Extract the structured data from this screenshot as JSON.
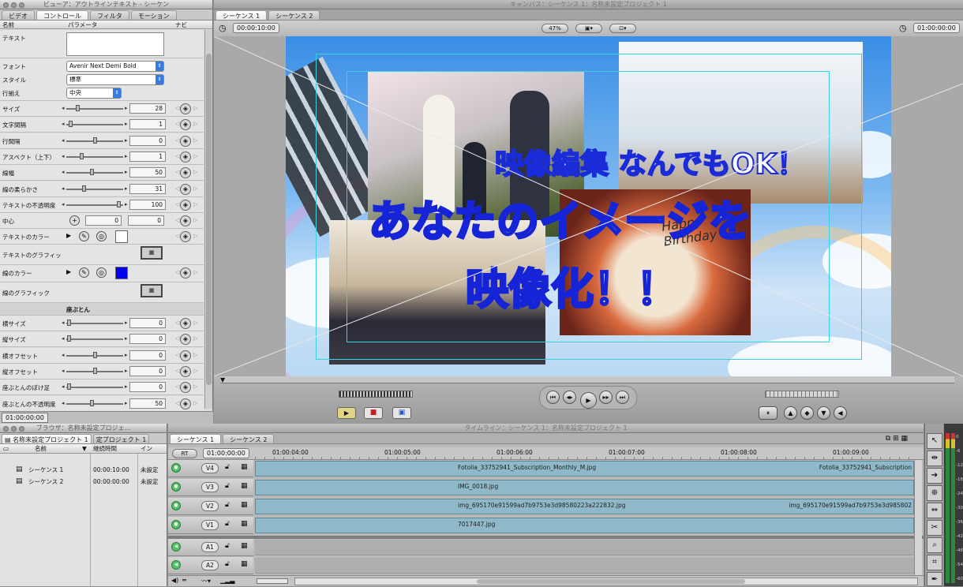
{
  "viewer": {
    "title": "ビューア：アウトラインテキスト - シーケン",
    "tabs": [
      "ビデオ",
      "コントロール",
      "フィルタ",
      "モーション"
    ],
    "active_tab": 1,
    "columns": {
      "name": "名前",
      "param": "パラメータ",
      "nav": "ナビ"
    },
    "text_label": "テキスト",
    "font": {
      "label": "フォント",
      "value": "Avenir Next Demi Bold"
    },
    "style": {
      "label": "スタイル",
      "value": "標準"
    },
    "align": {
      "label": "行揃え",
      "value": "中央"
    },
    "sliders": [
      {
        "label": "サイズ",
        "value": "28",
        "level": 0.18
      },
      {
        "label": "文字間隔",
        "value": "1",
        "level": 0.05
      },
      {
        "label": "行間隔",
        "value": "0",
        "level": 0.5
      },
      {
        "label": "アスペクト（上下）",
        "value": "1",
        "level": 0.25
      },
      {
        "label": "線幅",
        "value": "50",
        "level": 0.45
      },
      {
        "label": "線の柔らかさ",
        "value": "31",
        "level": 0.3
      },
      {
        "label": "テキストの不透明度",
        "value": "100",
        "level": 0.95
      }
    ],
    "center": {
      "label": "中心",
      "x": "0",
      "y": "0"
    },
    "text_color": {
      "label": "テキストのカラー",
      "color": "#ffffff"
    },
    "text_graphic": {
      "label": "テキストのグラフィッ"
    },
    "line_color": {
      "label": "線のカラー",
      "color": "#0000ee"
    },
    "line_graphic": {
      "label": "線のグラフィック"
    },
    "section": "座ぶとん",
    "sliders2": [
      {
        "label": "横サイズ",
        "value": "0",
        "level": 0.02
      },
      {
        "label": "縦サイズ",
        "value": "0",
        "level": 0.02
      },
      {
        "label": "横オフセット",
        "value": "0",
        "level": 0.5
      },
      {
        "label": "縦オフセット",
        "value": "0",
        "level": 0.5
      },
      {
        "label": "座ぶとんのぼけ足",
        "value": "0",
        "level": 0.02
      },
      {
        "label": "座ぶとんの不透明度",
        "value": "50",
        "level": 0.45
      }
    ],
    "timecode": "01:00:00:00"
  },
  "canvas": {
    "title": "キャンバス：シーケンス 1：名称未設定プロジェクト 1",
    "tabs": [
      "シーケンス 1",
      "シーケンス 2"
    ],
    "duration": "00:00:10:00",
    "zoom": "47%",
    "current_time": "01:00:00:00",
    "overlay_line1": "映像編集 なんでもOK！",
    "overlay_line2": "あなたのイメージを",
    "overlay_line3": "映像化！！",
    "cake_text": "Happy Birthday"
  },
  "browser": {
    "title": "ブラウザ：名称未設定プロジェ...",
    "tabs": [
      "名称未設定プロジェクト 1",
      "定プロジェクト 1"
    ],
    "columns": {
      "name": "名前",
      "duration": "継続時間",
      "in": "イン"
    },
    "items": [
      {
        "name": "シーケンス 1",
        "duration": "00:00:10:00",
        "in": "未設定"
      },
      {
        "name": "シーケンス 2",
        "duration": "00:00:00:00",
        "in": "未設定"
      }
    ]
  },
  "timeline": {
    "title": "タイムライン：シーケンス 1：名称未設定プロジェクト 1",
    "tabs": [
      "シーケンス 1",
      "シーケンス 2"
    ],
    "rt": "RT",
    "timecode": "01:00:00:00",
    "ruler": [
      "01:00:04:00",
      "01:00:05:00",
      "01:00:06:00",
      "01:00:07:00",
      "01:00:08:00",
      "01:00:09:00"
    ],
    "video_tracks": [
      {
        "name": "V4",
        "clip": "Fotolia_33752941_Subscription_Monthly_M.jpg",
        "clip_end": "Fotolia_33752941_Subscription"
      },
      {
        "name": "V3",
        "clip": "IMG_0018.jpg",
        "clip_end": ""
      },
      {
        "name": "V2",
        "clip": "img_695170e91599ad7b9753e3d98580223a222832.jpg",
        "clip_end": "img_695170e91599ad7b9753e3d985802"
      },
      {
        "name": "V1",
        "clip": "7017447.jpg",
        "clip_end": ""
      }
    ],
    "audio_tracks": [
      {
        "name": "A1"
      },
      {
        "name": "A2"
      }
    ]
  },
  "meters": {
    "labels": [
      "0",
      "-6",
      "-12",
      "-18",
      "-24",
      "-30",
      "-36",
      "-42",
      "-48",
      "-54",
      "-60"
    ]
  }
}
